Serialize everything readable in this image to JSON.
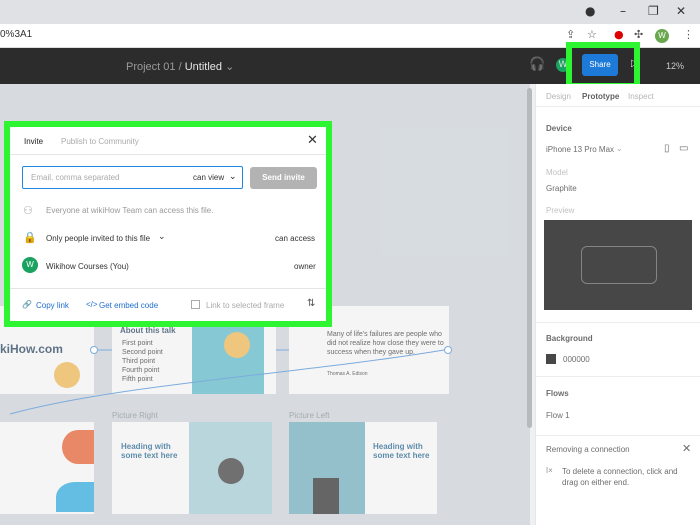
{
  "browser": {
    "url_fragment": "0%3A1",
    "icons": [
      "share-icon",
      "star-icon",
      "extension-icon",
      "puzzle-icon",
      "menu-dots-icon"
    ],
    "profile_initial": "W"
  },
  "toolbar": {
    "project": "Project 01",
    "separator": "/",
    "file_name": "Untitled",
    "share_label": "Share",
    "zoom": "12%",
    "user_initial": "W"
  },
  "canvas": {
    "frame_labels": [
      "Picture Right",
      "Picture Left"
    ],
    "about_title": "About this talk",
    "about_items": [
      "First point",
      "Second point",
      "Third point",
      "Fourth point",
      "Fifth point"
    ],
    "brand_text": "kiHow.com",
    "quote": "Many of life's failures are people who did not realize how close they were to success when they gave up.",
    "quote_author": "Thomas A. Edison",
    "heading_1": "Heading with some text here",
    "heading_2": "Heading with some text here"
  },
  "panel": {
    "tabs": [
      "Design",
      "Prototype",
      "Inspect"
    ],
    "active_tab": "Prototype",
    "device_heading": "Device",
    "device": "iPhone 13 Pro Max",
    "model_label": "Model",
    "model": "Graphite",
    "preview_label": "Preview",
    "background_heading": "Background",
    "background_value": "000000",
    "flows_heading": "Flows",
    "flow_item": "Flow 1",
    "removing_title": "Removing a connection",
    "removing_text": "To delete a connection, click and drag on either end."
  },
  "dialog": {
    "tabs": [
      "Invite",
      "Publish to Community"
    ],
    "active_tab": "Invite",
    "email_placeholder": "Email, comma separated",
    "permission": "can view",
    "send_label": "Send invite",
    "team_access": "Everyone at wikiHow Team can access this file.",
    "restriction": "Only people invited to this file",
    "restriction_permission": "can access",
    "member_initial": "W",
    "member_name": "Wikihow Courses (You)",
    "member_role": "owner",
    "copy_link": "Copy link",
    "embed": "Get embed code",
    "link_frame": "Link to selected frame"
  },
  "colors": {
    "highlight": "#2df531",
    "share_button": "#1e7ad8",
    "toolbar_bg": "#2c2c2c",
    "link": "#1e6fd0"
  }
}
